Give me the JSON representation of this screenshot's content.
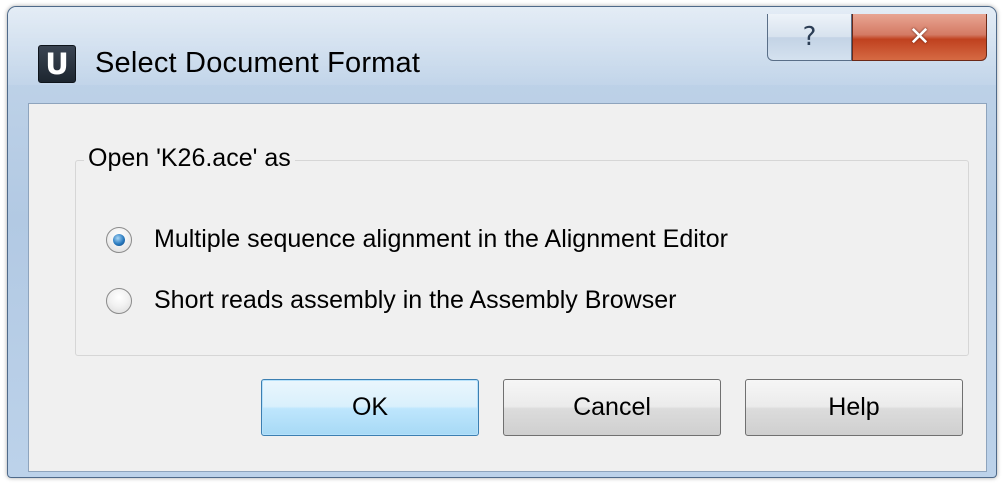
{
  "window": {
    "title": "Select Document Format",
    "app_icon_letter": "U",
    "help_glyph": "?",
    "close_glyph": "✕"
  },
  "group": {
    "title": "Open 'K26.ace' as",
    "options": [
      {
        "label": "Multiple sequence alignment in the Alignment Editor",
        "checked": true
      },
      {
        "label": "Short reads assembly in the Assembly Browser",
        "checked": false
      }
    ]
  },
  "buttons": {
    "ok": "OK",
    "cancel": "Cancel",
    "help": "Help"
  },
  "colors": {
    "accent": "#2a7bc0",
    "close_button": "#c0411f"
  }
}
